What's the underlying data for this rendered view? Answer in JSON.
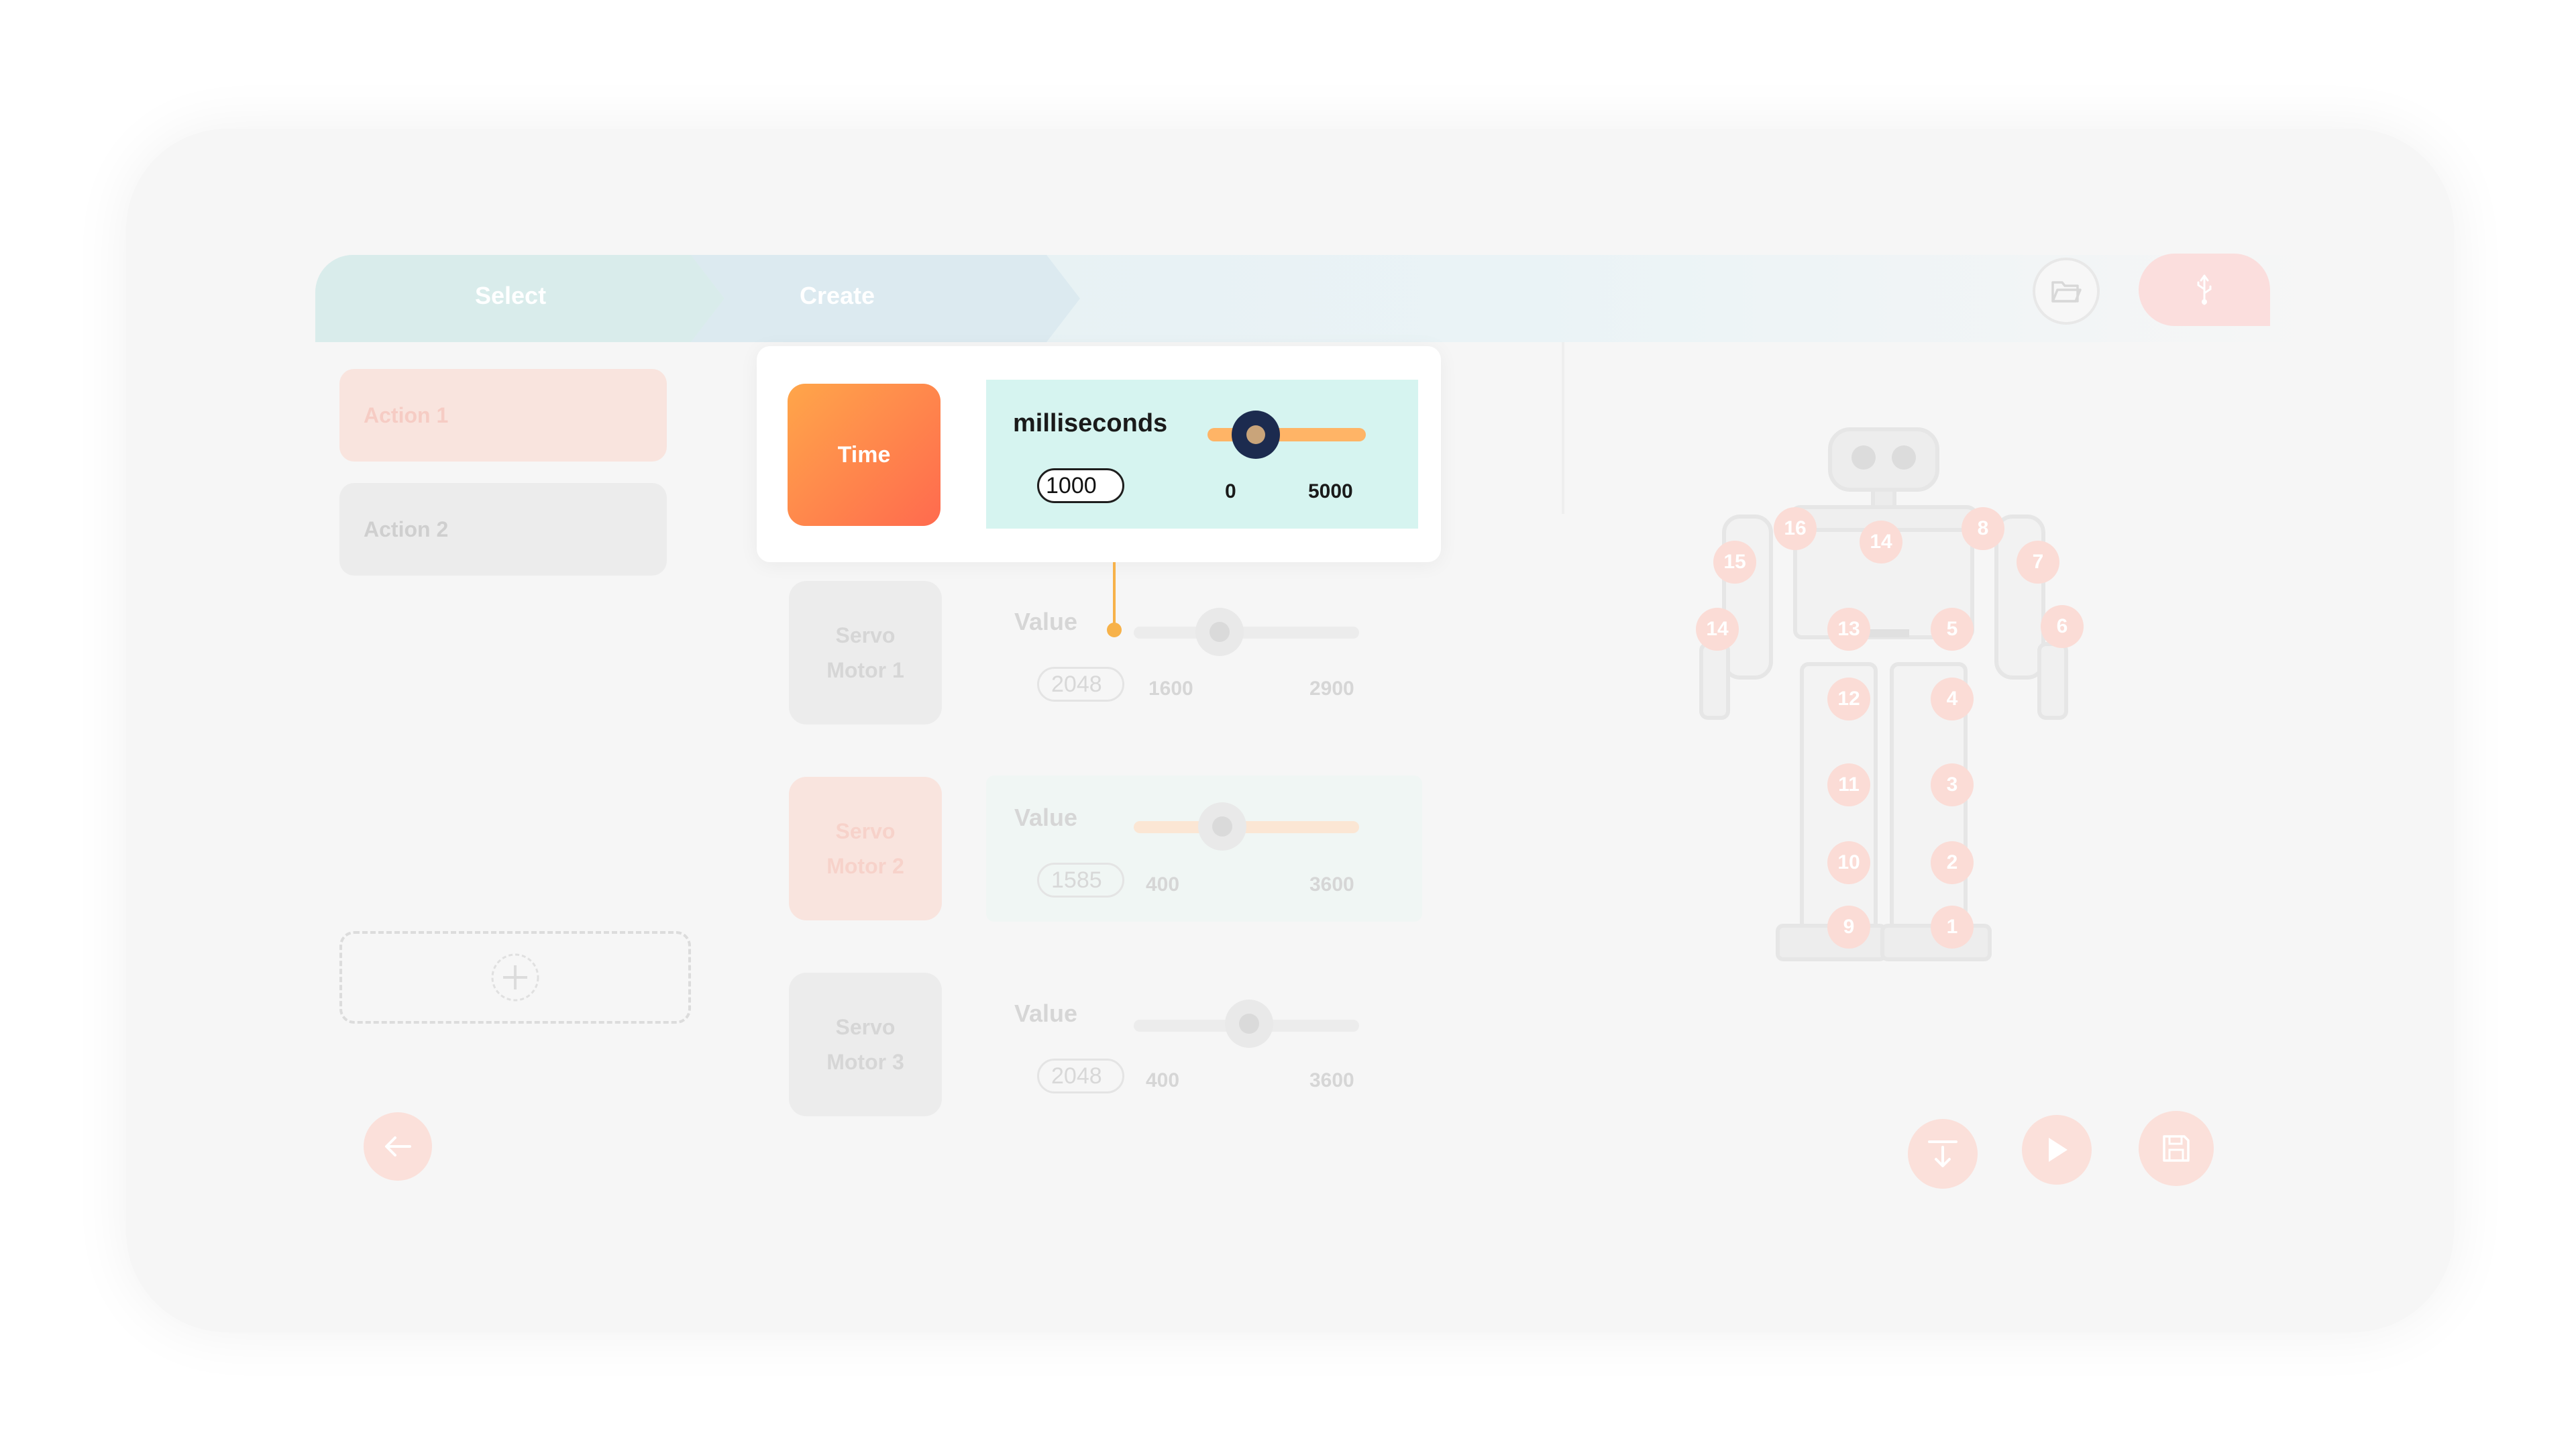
{
  "tabs": [
    {
      "label": "Select"
    },
    {
      "label": "Create"
    }
  ],
  "header": {
    "folder_icon": "folder-icon",
    "usb_icon": "usb-icon"
  },
  "actions": [
    {
      "label": "Action 1"
    },
    {
      "label": "Action 2"
    }
  ],
  "time_row": {
    "tile_label": "Time",
    "unit_label": "milliseconds",
    "value": "1000",
    "min": "0",
    "max": "5000"
  },
  "servo_rows": [
    {
      "tile_label": "Servo\nMotor 1",
      "label": "Value",
      "value": "2048",
      "min": "1600",
      "max": "2900"
    },
    {
      "tile_label": "Servo\nMotor 2",
      "label": "Value",
      "value": "1585",
      "min": "400",
      "max": "3600"
    },
    {
      "tile_label": "Servo\nMotor 3",
      "label": "Value",
      "value": "2048",
      "min": "400",
      "max": "3600"
    }
  ],
  "robot_servos": [
    "16",
    "14",
    "8",
    "15",
    "7",
    "14",
    "13",
    "5",
    "6",
    "12",
    "4",
    "11",
    "3",
    "10",
    "2",
    "9",
    "1"
  ],
  "colors": {
    "accent_orange": "#ff8a4c",
    "panel_teal": "#d6f4f0",
    "knob_navy": "#1c2b4f"
  }
}
